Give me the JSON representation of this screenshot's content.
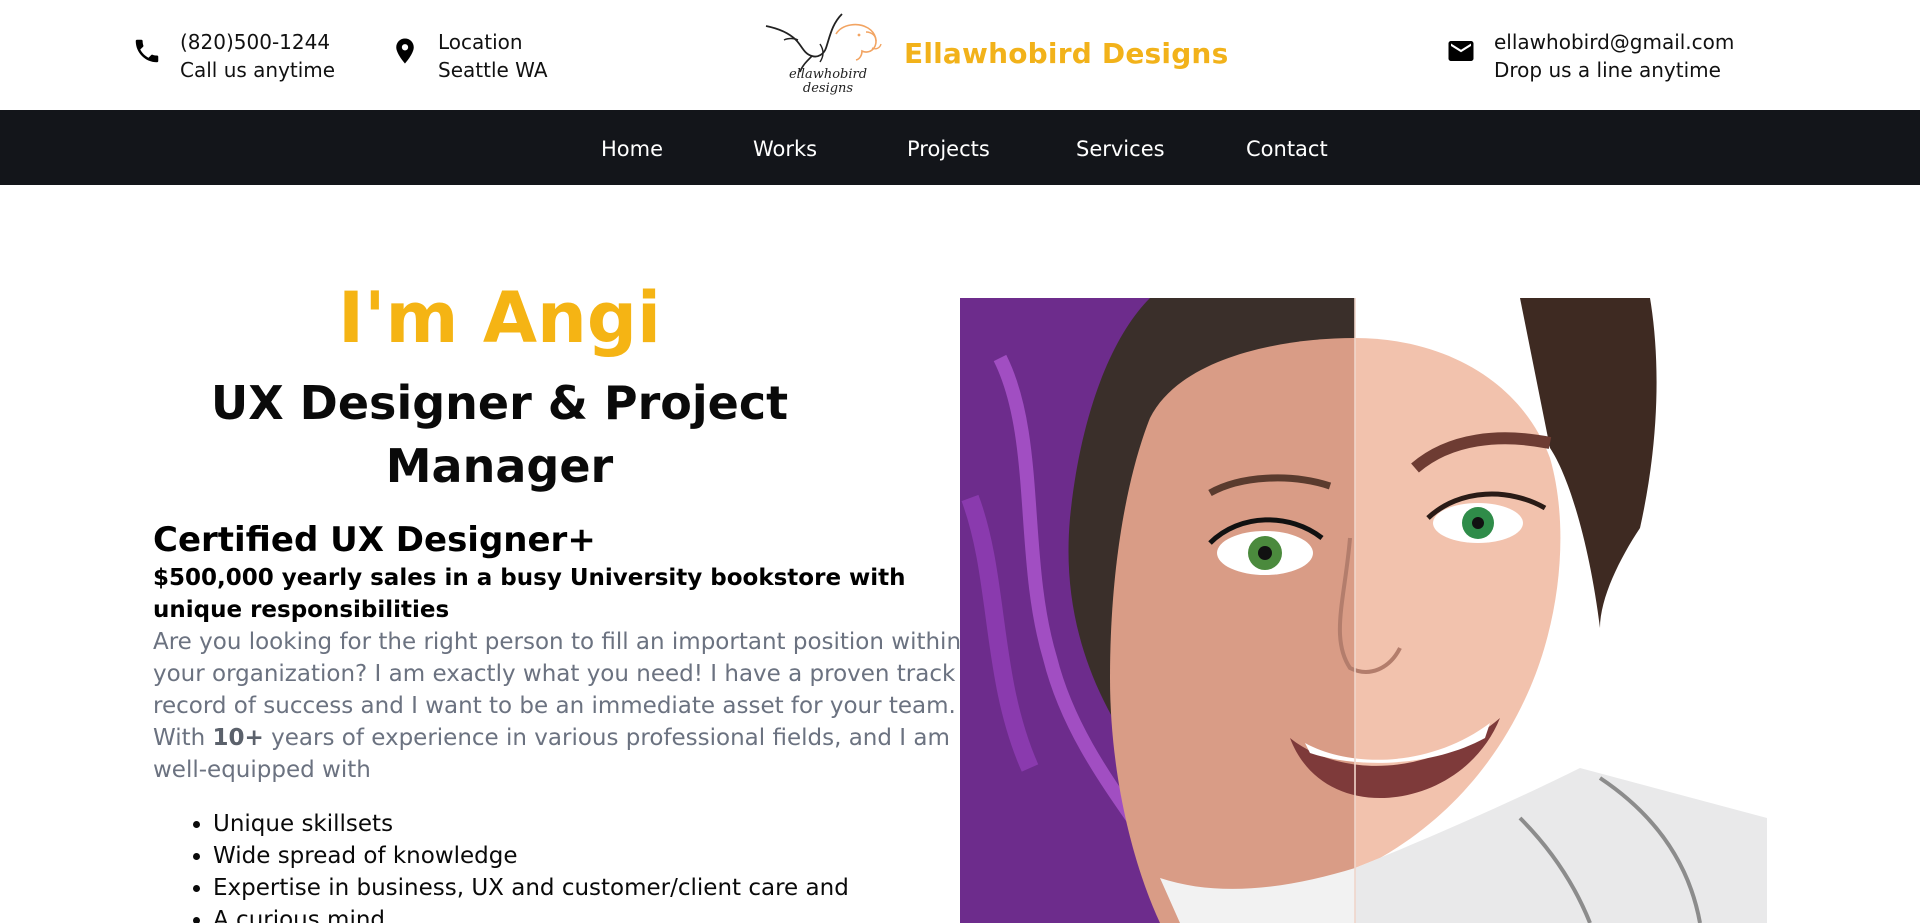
{
  "header": {
    "phone": {
      "icon": "phone-icon",
      "line1": "(820)500-1244",
      "line2": "Call us anytime"
    },
    "location": {
      "icon": "location-pin-icon",
      "line1": "Location",
      "line2": "Seattle WA"
    },
    "brand": {
      "logo_icon": "hummingbird-elephant-logo",
      "name": "Ellawhobird Designs"
    },
    "email": {
      "icon": "mail-icon",
      "line1": "ellawhobird@gmail.com",
      "line2": "Drop us a line anytime"
    }
  },
  "nav": {
    "items": [
      {
        "label": "Home"
      },
      {
        "label": "Works"
      },
      {
        "label": "Projects"
      },
      {
        "label": "Services"
      },
      {
        "label": "Contact"
      }
    ]
  },
  "hero": {
    "greeting": "I'm Angi",
    "role": "UX Designer & Project Manager",
    "certification": "Certified UX Designer+",
    "sales": "$500,000 yearly sales in a busy University bookstore with unique responsibilities",
    "intro_before": "Are you looking for the right person to fill an important position within your organization? I am exactly what you need! I have a proven track record of success and I want to be an immediate asset for your team. With ",
    "intro_bold": "10+",
    "intro_after": " years of experience in various professional fields, and I am well-equipped with",
    "bullets": [
      "Unique skillsets",
      "Wide spread of knowledge",
      "Expertise in business, UX and customer/client care and",
      "A curious mind"
    ]
  },
  "colors": {
    "accent": "#f5b414",
    "nav_bg": "#13151a",
    "body_text_muted": "#6b7280"
  }
}
